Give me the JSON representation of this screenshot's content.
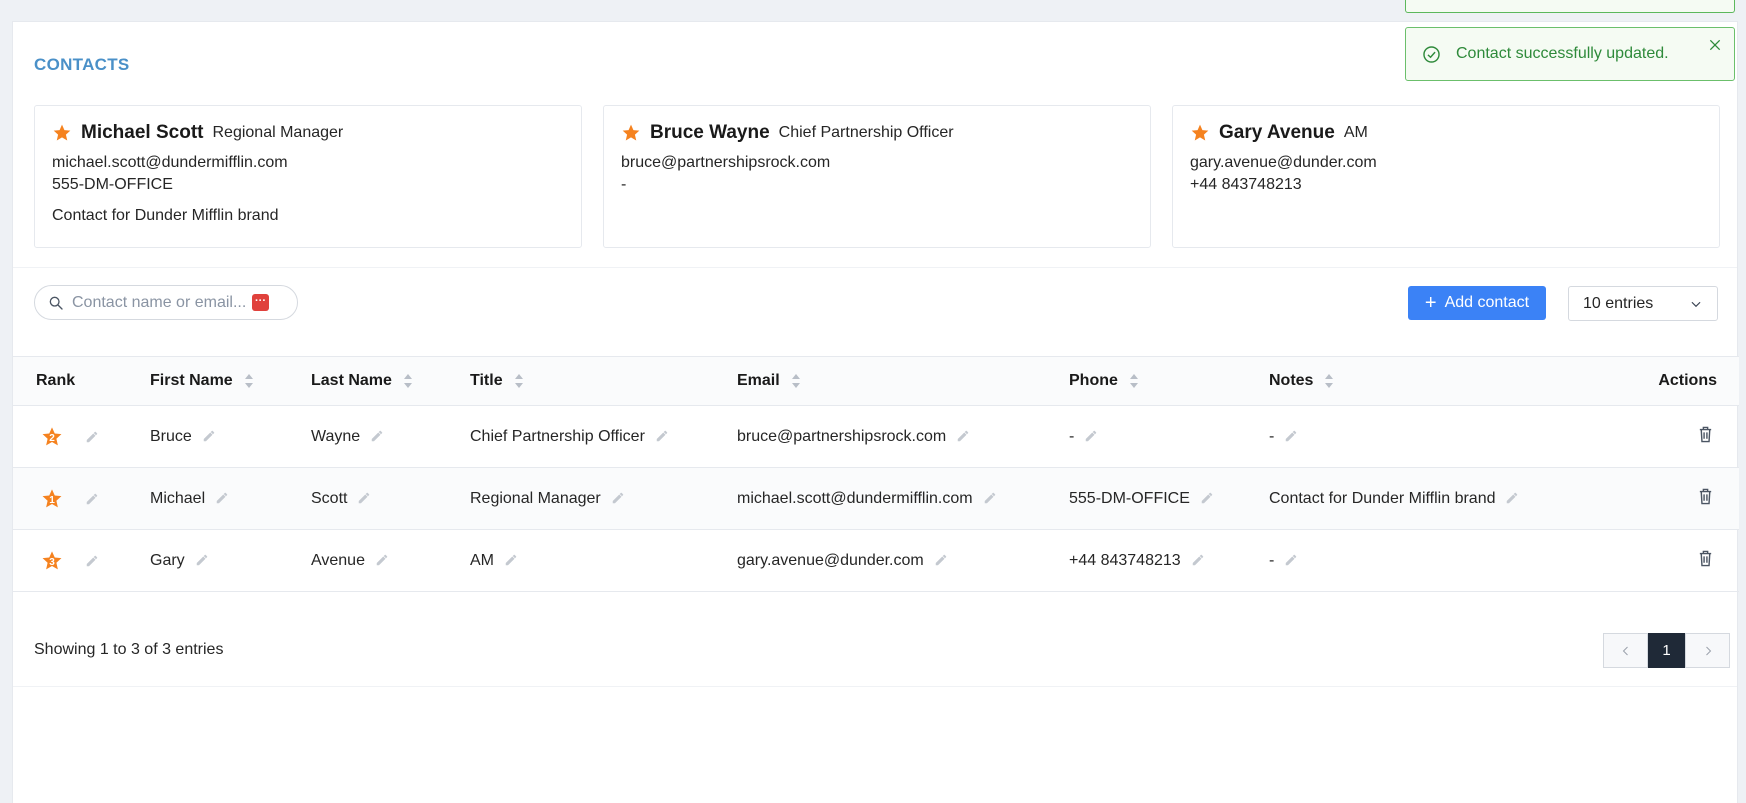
{
  "page": {
    "section_title": "CONTACTS"
  },
  "cards": [
    {
      "name": "Michael Scott",
      "role": "Regional Manager",
      "email": "michael.scott@dundermifflin.com",
      "phone": "555-DM-OFFICE",
      "note": "Contact for Dunder Mifflin brand"
    },
    {
      "name": "Bruce Wayne",
      "role": "Chief Partnership Officer",
      "email": "bruce@partnershipsrock.com",
      "phone": "-",
      "note": ""
    },
    {
      "name": "Gary Avenue",
      "role": "AM",
      "email": "gary.avenue@dunder.com",
      "phone": "+44 843748213",
      "note": ""
    }
  ],
  "toolbar": {
    "search_placeholder": "Contact name or email...",
    "add_label": "Add contact",
    "entries_label": "10 entries"
  },
  "table": {
    "headers": {
      "rank": "Rank",
      "first_name": "First Name",
      "last_name": "Last Name",
      "title": "Title",
      "email": "Email",
      "phone": "Phone",
      "notes": "Notes",
      "actions": "Actions"
    },
    "rows": [
      {
        "rank": "2",
        "first_name": "Bruce",
        "last_name": "Wayne",
        "title": "Chief Partnership Officer",
        "email": "bruce@partnershipsrock.com",
        "phone": "-",
        "notes": "-"
      },
      {
        "rank": "1",
        "first_name": "Michael",
        "last_name": "Scott",
        "title": "Regional Manager",
        "email": "michael.scott@dundermifflin.com",
        "phone": "555-DM-OFFICE",
        "notes": "Contact for Dunder Mifflin brand"
      },
      {
        "rank": "3",
        "first_name": "Gary",
        "last_name": "Avenue",
        "title": "AM",
        "email": "gary.avenue@dunder.com",
        "phone": "+44 843748213",
        "notes": "-"
      }
    ]
  },
  "footer": {
    "showing": "Showing 1 to 3 of 3 entries",
    "current_page": "1"
  },
  "toast": {
    "message": "Contact successfully updated."
  },
  "colors": {
    "accent": "#3b82f6",
    "star": "#f5821f",
    "title": "#4a90c8",
    "success": "#2e8a3a"
  },
  "icons": [
    "search-icon",
    "star-icon",
    "pencil-icon",
    "trash-icon",
    "plus-icon",
    "chevron-down-icon",
    "chevron-left-icon",
    "chevron-right-icon",
    "check-circle-icon",
    "close-icon"
  ]
}
